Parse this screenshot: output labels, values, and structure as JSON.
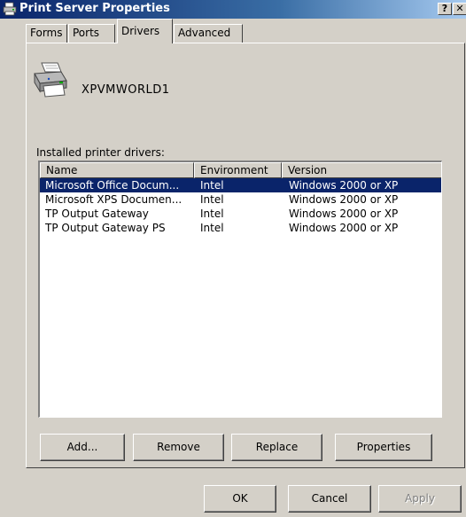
{
  "window": {
    "title": "Print Server Properties",
    "help_label": "?",
    "close_label": "✕"
  },
  "tabs": [
    {
      "label": "Forms",
      "active": false
    },
    {
      "label": "Ports",
      "active": false
    },
    {
      "label": "Drivers",
      "active": true
    },
    {
      "label": "Advanced",
      "active": false
    }
  ],
  "server": {
    "name": "XPVMWORLD1",
    "icon": "printer-server-icon"
  },
  "drivers": {
    "label": "Installed printer drivers:",
    "columns": [
      "Name",
      "Environment",
      "Version"
    ],
    "rows": [
      {
        "name": "Microsoft Office Docum...",
        "environment": "Intel",
        "version": "Windows 2000 or XP",
        "selected": true
      },
      {
        "name": "Microsoft XPS Documen...",
        "environment": "Intel",
        "version": "Windows 2000 or XP",
        "selected": false
      },
      {
        "name": "TP Output Gateway",
        "environment": "Intel",
        "version": "Windows 2000 or XP",
        "selected": false
      },
      {
        "name": "TP Output Gateway PS",
        "environment": "Intel",
        "version": "Windows 2000 or XP",
        "selected": false
      }
    ]
  },
  "buttons": {
    "add": "Add...",
    "remove": "Remove",
    "replace": "Replace",
    "properties": "Properties",
    "ok": "OK",
    "cancel": "Cancel",
    "apply": "Apply"
  },
  "colors": {
    "selection": "#0a246a",
    "face": "#d4d0c8"
  }
}
